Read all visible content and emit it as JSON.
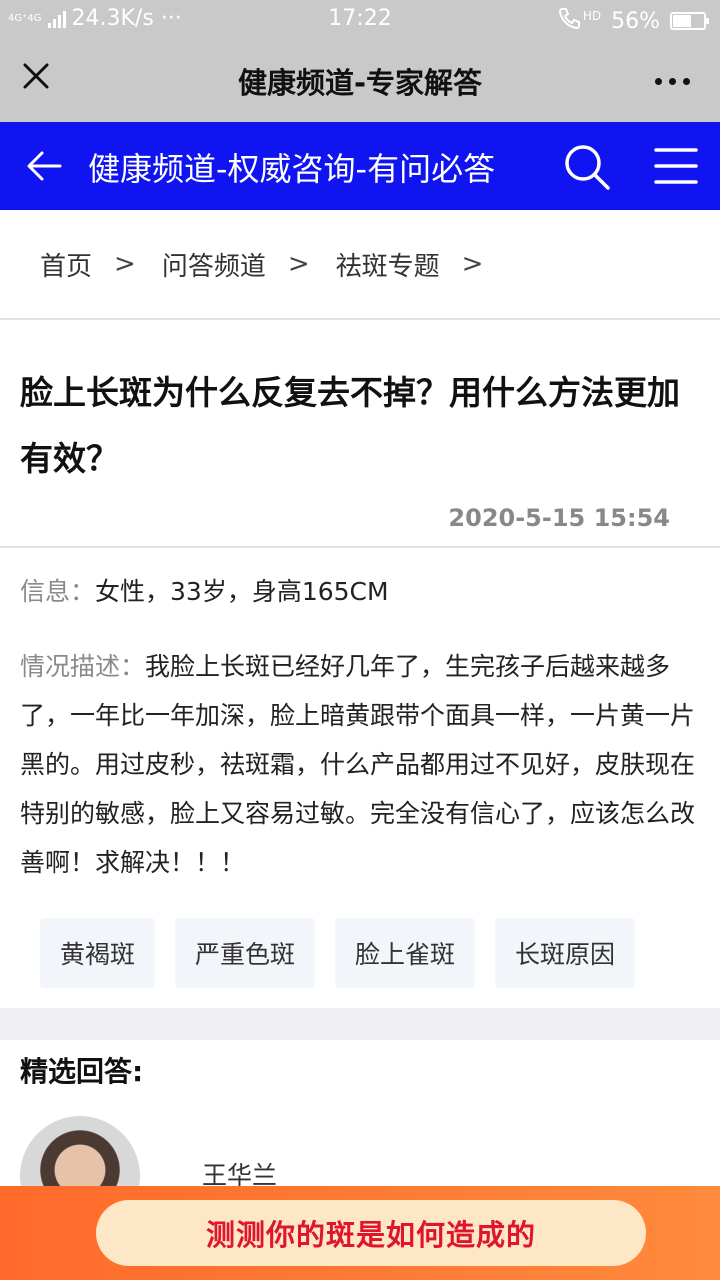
{
  "status_bar": {
    "network_tag": "4G⁺4G",
    "speed": "24.3K/s ···",
    "time": "17:22",
    "hd_tag": "HD",
    "battery_percent_text": "56%",
    "battery_level": 0.56
  },
  "title_bar": {
    "title": "健康频道-专家解答"
  },
  "site_header": {
    "title": "健康频道-权威咨询-有问必答",
    "color": "#0f14f0"
  },
  "breadcrumb": {
    "items": [
      "首页",
      "问答频道",
      "祛斑专题"
    ],
    "separator": ">"
  },
  "question": {
    "title": "脸上长斑为什么反复去不掉？用什么方法更加有效？",
    "date": "2020-5-15 15:54"
  },
  "info": {
    "label": "信息：",
    "value": "女性，33岁，身高165CM"
  },
  "description": {
    "label": "情况描述：",
    "text": "我脸上长斑已经好几年了，生完孩子后越来越多了，一年比一年加深，脸上暗黄跟带个面具一样，一片黄一片黑的。用过皮秒，祛斑霜，什么产品都用过不见好，皮肤现在特别的敏感，脸上又容易过敏。完全没有信心了，应该怎么改善啊！求解决！！！"
  },
  "tags": [
    "黄褐斑",
    "严重色斑",
    "脸上雀斑",
    "长斑原因"
  ],
  "answers": {
    "heading": "精选回答:",
    "expert_name": "王华兰"
  },
  "cta": {
    "label": "测测你的斑是如何造成的",
    "text_color": "#e0142a"
  }
}
